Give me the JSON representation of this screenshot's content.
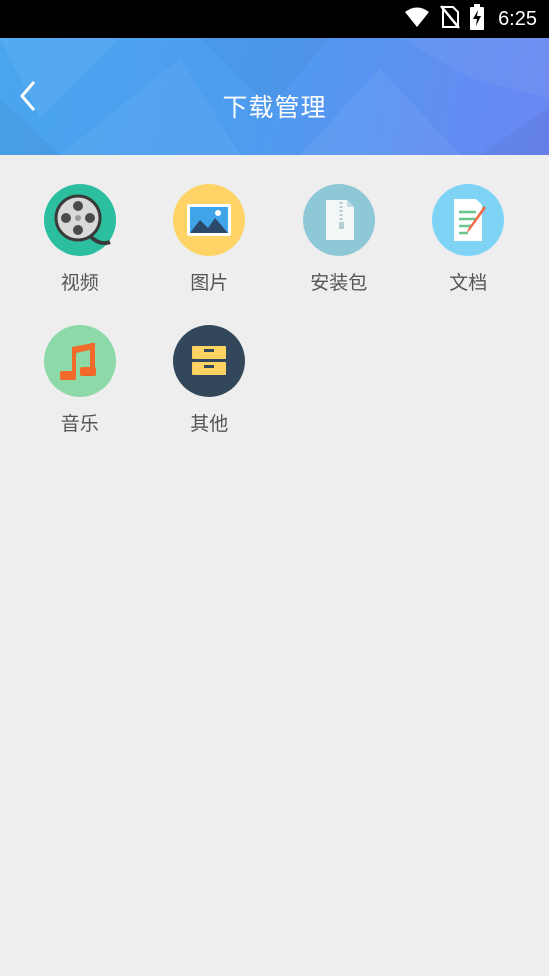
{
  "status_bar": {
    "time": "6:25",
    "icons": [
      "wifi-icon",
      "no-sim-icon",
      "battery-charging-icon"
    ]
  },
  "header": {
    "title": "下载管理",
    "back_icon": "chevron-left-icon",
    "gradient_colors": [
      "#4aa6ee",
      "#6a86f2"
    ]
  },
  "categories": [
    {
      "label": "视频",
      "icon": "film-reel-icon",
      "bg_color": "#2bbfa0"
    },
    {
      "label": "图片",
      "icon": "image-icon",
      "bg_color": "#ffd366"
    },
    {
      "label": "安装包",
      "icon": "zip-file-icon",
      "bg_color": "#8ec8d6"
    },
    {
      "label": "文档",
      "icon": "document-edit-icon",
      "bg_color": "#7fd3f5"
    },
    {
      "label": "音乐",
      "icon": "music-note-icon",
      "bg_color": "#8dd9a7"
    },
    {
      "label": "其他",
      "icon": "drawer-icon",
      "bg_color": "#33475b"
    }
  ]
}
